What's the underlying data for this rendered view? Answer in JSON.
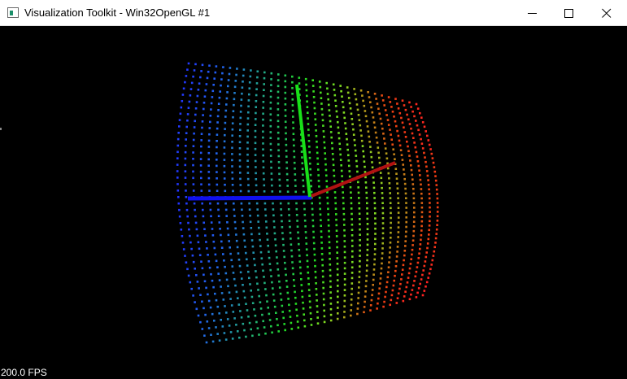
{
  "window": {
    "title": "Visualization Toolkit - Win32OpenGL #1",
    "app_icon": "vtk-window-icon",
    "controls": {
      "minimize": "minimize-icon",
      "maximize": "maximize-icon",
      "close": "close-icon"
    }
  },
  "viewport": {
    "background": "#000000",
    "fps_text": "200.0 FPS",
    "scene": {
      "type": "point-cloud-cylindrical-shell",
      "colormap": [
        "#2233ff",
        "#2266ee",
        "#22aa88",
        "#22dd22",
        "#88dd22",
        "#ee4411",
        "#ff2222"
      ],
      "axes": {
        "x_axis_color": "#b01212",
        "y_axis_color": "#18e018",
        "z_axis_color": "#1010f0"
      }
    }
  }
}
